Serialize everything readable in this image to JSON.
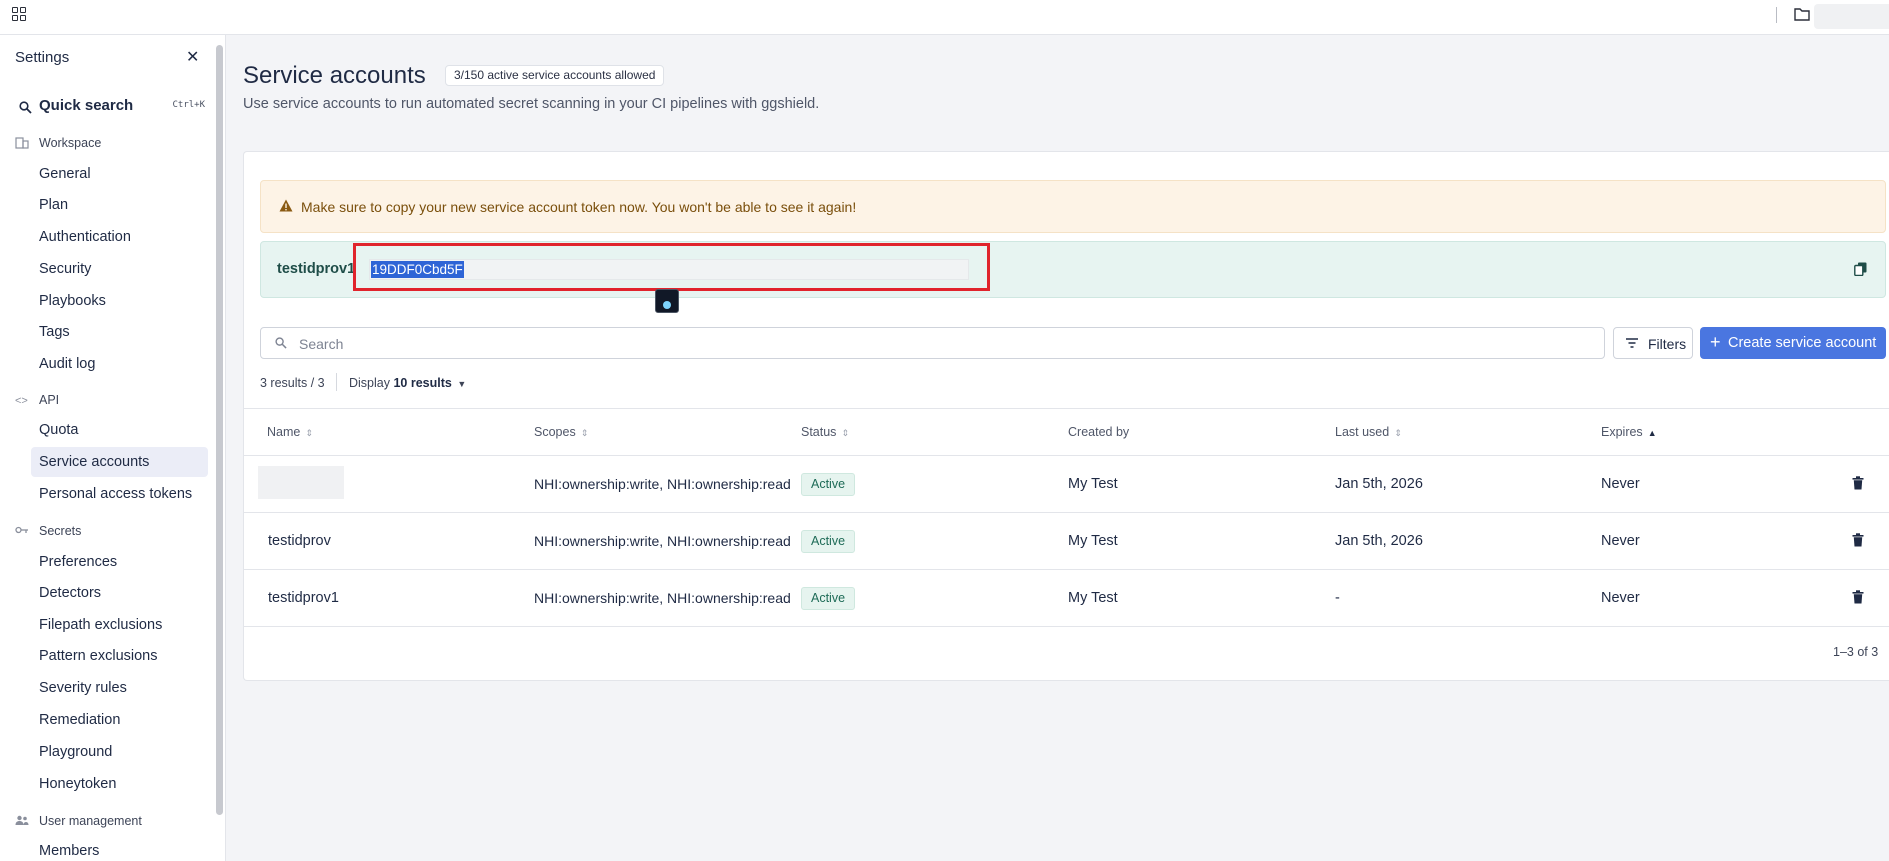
{
  "sidebar": {
    "title": "Settings",
    "quick_search": {
      "label": "Quick search",
      "shortcut": "Ctrl+K"
    },
    "sections": {
      "workspace": "Workspace",
      "api": "API",
      "secrets": "Secrets",
      "user_management": "User management"
    },
    "workspace_items": [
      "General",
      "Plan",
      "Authentication",
      "Security",
      "Playbooks",
      "Tags",
      "Audit log"
    ],
    "api_items": [
      "Quota",
      "Service accounts",
      "Personal access tokens"
    ],
    "secrets_items": [
      "Preferences",
      "Detectors",
      "Filepath exclusions",
      "Pattern exclusions",
      "Severity rules",
      "Remediation",
      "Playground",
      "Honeytoken"
    ],
    "user_items": [
      "Members"
    ],
    "active_item": "Service accounts"
  },
  "page": {
    "title": "Service accounts",
    "badge": "3/150 active service accounts allowed",
    "subtitle": "Use service accounts to run automated secret scanning in your CI pipelines with ggshield."
  },
  "warning": {
    "text": "Make sure to copy your new service account token now. You won't be able to see it again!"
  },
  "token": {
    "name": "testidprov1",
    "value": "19DDF0Cbd5F"
  },
  "search": {
    "placeholder": "Search"
  },
  "toolbar": {
    "filters_label": "Filters",
    "create_label": "Create service account"
  },
  "results": {
    "summary": "3 results / 3",
    "display_label": "Display",
    "display_value": "10 results"
  },
  "table": {
    "headers": {
      "name": "Name",
      "scopes": "Scopes",
      "status": "Status",
      "created_by": "Created by",
      "last_used": "Last used",
      "expires": "Expires"
    },
    "rows": [
      {
        "name": "",
        "scopes": "NHI:ownership:write, NHI:ownership:read",
        "status": "Active",
        "created_by": "My Test",
        "last_used": "Jan 5th, 2026",
        "expires": "Never"
      },
      {
        "name": "testidprov",
        "scopes": "NHI:ownership:write, NHI:ownership:read",
        "status": "Active",
        "created_by": "My Test",
        "last_used": "Jan 5th, 2026",
        "expires": "Never"
      },
      {
        "name": "testidprov1",
        "scopes": "NHI:ownership:write, NHI:ownership:read",
        "status": "Active",
        "created_by": "My Test",
        "last_used": "-",
        "expires": "Never"
      }
    ],
    "pagination": "1–3 of 3"
  },
  "icons": [
    "apps-grid-icon",
    "folder-icon",
    "close-icon",
    "search-icon",
    "building-icon",
    "code-icon",
    "key-icon",
    "users-icon",
    "warning-icon",
    "copy-icon",
    "filter-icon",
    "plus-icon",
    "chevron-down-icon",
    "sort-icon",
    "trash-icon"
  ],
  "colors": {
    "primary": "#4a76e0",
    "warning_bg": "#fdf3e6",
    "token_bg": "#e7f4f1",
    "active_badge": "#e6f4ef",
    "highlight": "#e0242c"
  }
}
